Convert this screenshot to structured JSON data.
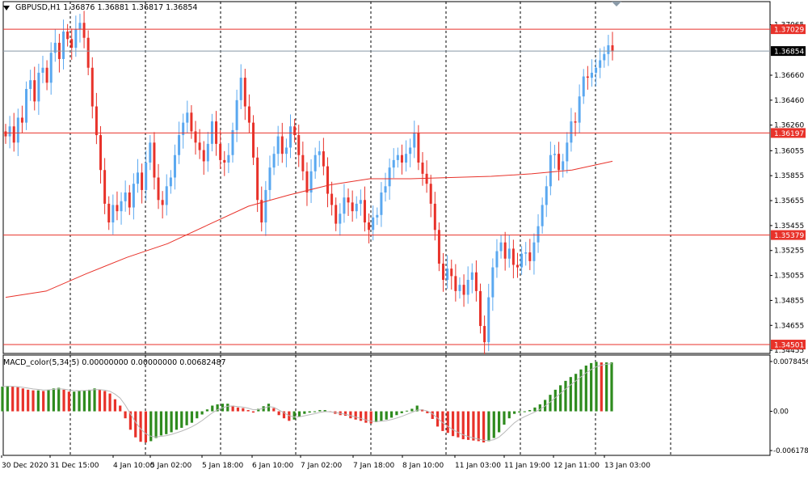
{
  "header": {
    "menu_icon": "triangle-down-icon",
    "symbol": "GBPUSD,H1",
    "open": "1.36876",
    "high": "1.36881",
    "low": "1.36817",
    "close": "1.36854"
  },
  "macd_header": {
    "name": "MACD_color(5,34,5)",
    "v1": "0.00000000",
    "v2": "0.00000000",
    "v3": "0.00682487"
  },
  "colors": {
    "bull": "#5aa8f0",
    "bear": "#e8322a",
    "ma": "#e8322a",
    "level": "#e8322a",
    "bid_line": "#8899a6",
    "macd_pos": "#2e8b1e",
    "macd_neg": "#e8322a",
    "signal": "#b8b8b8",
    "grid": "#000000"
  },
  "chart_data": [
    {
      "type": "line",
      "title": "GBPUSD,H1",
      "ylim": [
        1.3443,
        1.3725
      ],
      "y_ticks": [
        "1.37065",
        "1.36660",
        "1.36460",
        "1.36260",
        "1.36055",
        "1.35855",
        "1.35655",
        "1.35455",
        "1.35255",
        "1.35055",
        "1.34855",
        "1.34655",
        "1.34455"
      ],
      "x_ticks": [
        "30 Dec 2020",
        "31 Dec 15:00",
        "4 Jan 10:00",
        "5 Jan 02:00",
        "5 Jan 18:00",
        "6 Jan 10:00",
        "7 Jan 02:00",
        "7 Jan 18:00",
        "8 Jan 10:00",
        "11 Jan 03:00",
        "11 Jan 19:00",
        "12 Jan 11:00",
        "13 Jan 03:00"
      ],
      "price_levels": [
        {
          "label": "1.37029",
          "value": 1.37029
        },
        {
          "label": "1.36197",
          "value": 1.36197
        },
        {
          "label": "1.35379",
          "value": 1.35379
        },
        {
          "label": "1.34501",
          "value": 1.34501
        }
      ],
      "bid": {
        "label": "1.36854",
        "value": 1.36854
      },
      "series": [
        {
          "name": "close",
          "values": [
            1.3617,
            1.3625,
            1.3612,
            1.3632,
            1.3628,
            1.3655,
            1.3662,
            1.3645,
            1.3668,
            1.3672,
            1.366,
            1.3684,
            1.3692,
            1.3679,
            1.3701,
            1.3695,
            1.3688,
            1.3703,
            1.3708,
            1.3696,
            1.3672,
            1.3641,
            1.3618,
            1.359,
            1.3563,
            1.3548,
            1.3562,
            1.3557,
            1.3565,
            1.3572,
            1.356,
            1.3579,
            1.3588,
            1.3574,
            1.3596,
            1.3612,
            1.3584,
            1.3566,
            1.3562,
            1.3577,
            1.3584,
            1.3602,
            1.3618,
            1.3628,
            1.3636,
            1.3621,
            1.3612,
            1.3606,
            1.3597,
            1.3611,
            1.3629,
            1.3611,
            1.3598,
            1.3596,
            1.3602,
            1.3622,
            1.3646,
            1.3664,
            1.3641,
            1.3628,
            1.36,
            1.3566,
            1.3548,
            1.3574,
            1.3592,
            1.3603,
            1.3617,
            1.3603,
            1.3608,
            1.3625,
            1.3618,
            1.3602,
            1.3589,
            1.3572,
            1.3589,
            1.3602,
            1.3605,
            1.3593,
            1.3571,
            1.3562,
            1.3547,
            1.3555,
            1.3568,
            1.3564,
            1.3557,
            1.3563,
            1.3566,
            1.3548,
            1.3542,
            1.3552,
            1.3554,
            1.3572,
            1.3577,
            1.3592,
            1.3598,
            1.3602,
            1.3596,
            1.3603,
            1.3608,
            1.362,
            1.3596,
            1.3587,
            1.3579,
            1.3563,
            1.3542,
            1.3515,
            1.3502,
            1.3511,
            1.3505,
            1.3493,
            1.3498,
            1.349,
            1.3502,
            1.3508,
            1.3493,
            1.3465,
            1.3452,
            1.3488,
            1.3512,
            1.3525,
            1.3532,
            1.3519,
            1.3527,
            1.3514,
            1.3512,
            1.3523,
            1.3524,
            1.3517,
            1.3532,
            1.3545,
            1.3562,
            1.3577,
            1.3602,
            1.3603,
            1.359,
            1.3597,
            1.3612,
            1.3629,
            1.3628,
            1.3649,
            1.3665,
            1.3664,
            1.3668,
            1.3672,
            1.3678,
            1.3683,
            1.369,
            1.3685
          ]
        },
        {
          "name": "moving-average",
          "values": [
            1.3488,
            1.3493,
            1.3507,
            1.352,
            1.3531,
            1.3546,
            1.3561,
            1.357,
            1.3578,
            1.3583,
            1.3583,
            1.3584,
            1.3585,
            1.3587,
            1.359,
            1.3597
          ]
        }
      ]
    },
    {
      "type": "bar",
      "title": "MACD_color(5,34,5)",
      "ylim": [
        -0.00617,
        0.00784
      ],
      "y_ticks": [
        "0.0078456",
        "0.00",
        "-0.0061780"
      ],
      "series": [
        {
          "name": "histogram",
          "values": [
            0.0039,
            0.004,
            0.0039,
            0.0038,
            0.0036,
            0.0034,
            0.0033,
            0.0033,
            0.0032,
            0.0034,
            0.0036,
            0.0037,
            0.0034,
            0.0031,
            0.0031,
            0.0032,
            0.0033,
            0.0034,
            0.0036,
            0.0034,
            0.0032,
            0.0028,
            0.0019,
            0.0009,
            -0.0011,
            -0.0029,
            -0.0041,
            -0.0048,
            -0.0049,
            -0.0047,
            -0.0042,
            -0.0038,
            -0.0036,
            -0.0033,
            -0.0029,
            -0.0026,
            -0.0022,
            -0.0018,
            -0.0011,
            -0.0005,
            0.0003,
            0.0009,
            0.0011,
            0.0012,
            0.0012,
            0.0009,
            0.0006,
            0.0005,
            0.0002,
            -0.0002,
            0.0004,
            0.0008,
            0.0012,
            0.0005,
            -0.0006,
            -0.0011,
            -0.0015,
            -0.0013,
            -0.0008,
            -0.0004,
            -0.0002,
            -0.0001,
            0.0002,
            0.0002,
            -0.0001,
            -0.0004,
            -0.0006,
            -0.0007,
            -0.0011,
            -0.0013,
            -0.0015,
            -0.0018,
            -0.0019,
            -0.0017,
            -0.0015,
            -0.0013,
            -0.001,
            -0.0006,
            -0.0003,
            0.0001,
            0.0004,
            0.0009,
            0.0003,
            -0.0003,
            -0.0012,
            -0.0024,
            -0.0031,
            -0.0034,
            -0.0039,
            -0.0041,
            -0.0044,
            -0.0045,
            -0.0046,
            -0.0047,
            -0.0049,
            -0.0047,
            -0.0042,
            -0.0033,
            -0.0021,
            -0.0011,
            -0.0004,
            -0.0002,
            -0.0001,
            0.0002,
            0.0006,
            0.0011,
            0.0018,
            0.0026,
            0.0034,
            0.0041,
            0.0048,
            0.0054,
            0.0059,
            0.0066,
            0.0072,
            0.0076,
            0.0078,
            0.0077,
            0.0077,
            0.0077
          ]
        }
      ]
    }
  ]
}
